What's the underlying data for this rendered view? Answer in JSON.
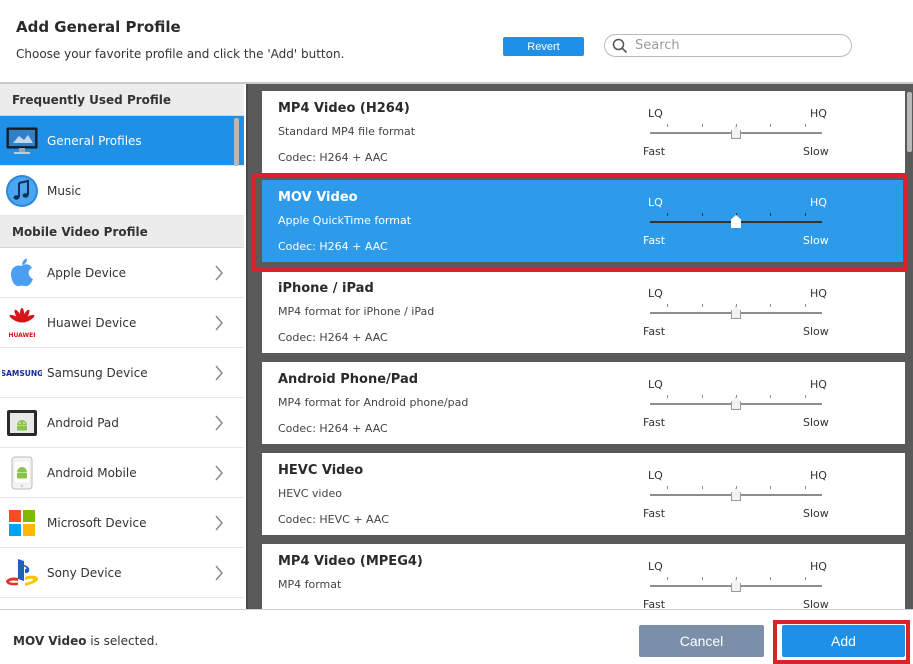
{
  "header": {
    "title": "Add General Profile",
    "subtitle": "Choose your favorite profile and click the 'Add' button.",
    "revert_label": "Revert",
    "search_placeholder": "Search"
  },
  "sidebar": {
    "sections": [
      {
        "title": "Frequently Used Profile",
        "items": [
          {
            "label": "General Profiles",
            "icon": "monitor-icon",
            "active": true,
            "chevron": false
          },
          {
            "label": "Music",
            "icon": "music-note-icon",
            "active": false,
            "chevron": false
          }
        ]
      },
      {
        "title": "Mobile Video Profile",
        "items": [
          {
            "label": "Apple Device",
            "icon": "apple-logo-icon",
            "active": false,
            "chevron": true
          },
          {
            "label": "Huawei Device",
            "icon": "huawei-logo-icon",
            "active": false,
            "chevron": true
          },
          {
            "label": "Samsung Device",
            "icon": "samsung-logo-icon",
            "active": false,
            "chevron": true
          },
          {
            "label": "Android Pad",
            "icon": "android-tablet-icon",
            "active": false,
            "chevron": true
          },
          {
            "label": "Android Mobile",
            "icon": "android-phone-icon",
            "active": false,
            "chevron": true
          },
          {
            "label": "Microsoft Device",
            "icon": "microsoft-logo-icon",
            "active": false,
            "chevron": true
          },
          {
            "label": "Sony Device",
            "icon": "playstation-logo-icon",
            "active": false,
            "chevron": true
          }
        ]
      }
    ]
  },
  "slider_labels": {
    "lq": "LQ",
    "hq": "HQ",
    "fast": "Fast",
    "slow": "Slow"
  },
  "profiles": [
    {
      "name": "MP4 Video (H264)",
      "description": "Standard MP4 file format",
      "codec": "Codec: H264 + AAC",
      "quality": 0.5,
      "selected": false
    },
    {
      "name": "MOV Video",
      "description": "Apple QuickTime format",
      "codec": "Codec: H264 + AAC",
      "quality": 0.5,
      "selected": true
    },
    {
      "name": "iPhone / iPad",
      "description": "MP4 format for iPhone / iPad",
      "codec": "Codec: H264 + AAC",
      "quality": 0.5,
      "selected": false
    },
    {
      "name": "Android Phone/Pad",
      "description": "MP4 format for Android phone/pad",
      "codec": "Codec: H264 + AAC",
      "quality": 0.5,
      "selected": false
    },
    {
      "name": "HEVC Video",
      "description": "HEVC video",
      "codec": "Codec: HEVC + AAC",
      "quality": 0.5,
      "selected": false
    },
    {
      "name": "MP4 Video (MPEG4)",
      "description": "MP4 format",
      "codec": "",
      "quality": 0.5,
      "selected": false
    }
  ],
  "footer": {
    "selected_name": "MOV Video",
    "status_suffix": " is selected.",
    "cancel_label": "Cancel",
    "add_label": "Add"
  },
  "colors": {
    "accent": "#1e90e8",
    "selected_card": "#2e9aea",
    "highlight_outline": "#d9232a",
    "cancel_button": "#7b8fa8",
    "content_bg": "#5a5a5a"
  }
}
